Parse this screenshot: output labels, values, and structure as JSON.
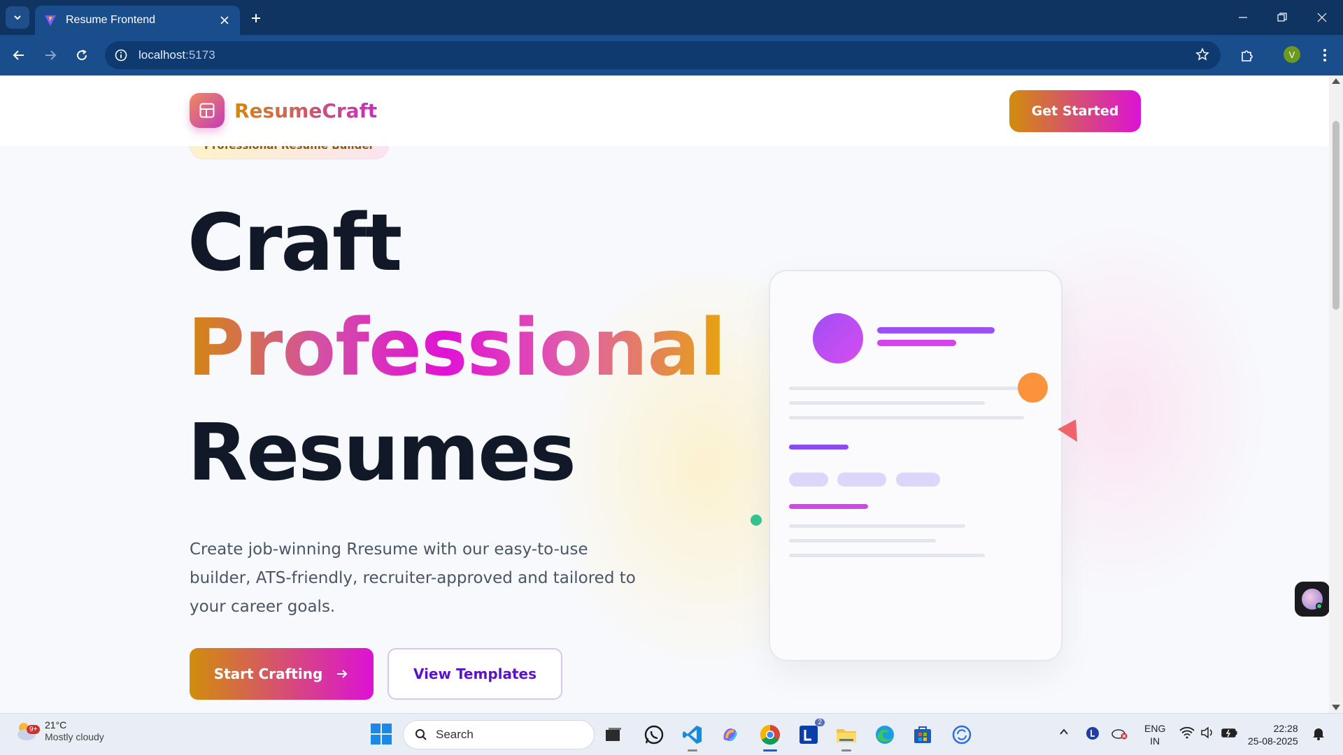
{
  "browser": {
    "tab_title": "Resume Frontend",
    "url_host": "localhost",
    "url_port": ":5173",
    "profile_initial": "V"
  },
  "site": {
    "brand_name": "ResumeCraft",
    "cta_header": "Get Started",
    "badge": "Professional Resume Builder",
    "hero_line1": "Craft",
    "hero_line2": "Professional",
    "hero_line3": "Resumes",
    "description": "Create job-winning Rresume with our easy-to-use builder, ATS-friendly, recruiter-approved and tailored to your career goals.",
    "primary_button": "Start Crafting",
    "secondary_button": "View Templates"
  },
  "taskbar": {
    "weather_temp": "21°C",
    "weather_desc": "Mostly cloudy",
    "weather_alert": "9+",
    "search_placeholder": "Search",
    "linkedin_badge": "2",
    "lang_1": "ENG",
    "lang_2": "IN",
    "time": "22:28",
    "date": "25-08-2025"
  },
  "colors": {
    "brand_gradient_start": "#d18d0c",
    "brand_gradient_end": "#dc12d6",
    "chrome_bar": "#1a4d8c",
    "hero_text": "#111827"
  }
}
